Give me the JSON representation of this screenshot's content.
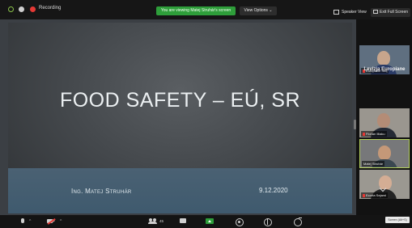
{
  "topbar": {
    "recording_label": "Recording",
    "viewing_banner": "You are viewing Matej Struhár's screen",
    "view_options": "View Options ⌄",
    "speaker_view": "Speaker View",
    "exit_fullscreen": "Exit Full Screen"
  },
  "slide": {
    "title": "FOOD SAFETY – EÚ, SR",
    "author": "Ing. Matej Struhár",
    "date": "9.12.2020"
  },
  "panel": {
    "featured_name": "Levizja Europiane",
    "participants": [
      {
        "name": "Europiane Shq"
      },
      {
        "name": "Florian Illiaku"
      },
      {
        "name": "Matej Struhár"
      },
      {
        "name": "Ecorta Sejami"
      }
    ],
    "screen_label": "Screen (Alt+S)"
  },
  "toolbar": {
    "audio_caret": "^",
    "video_caret": "^",
    "participants_count": "45"
  },
  "colors": {
    "banner_green": "#2e9e3a",
    "recording_red": "#e53935",
    "active_speaker_border": "#b5d15d"
  }
}
